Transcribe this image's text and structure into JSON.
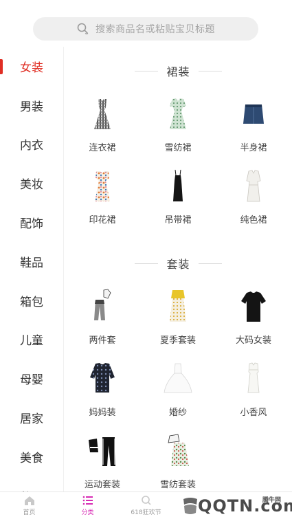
{
  "search": {
    "placeholder": "搜索商品名或粘贴宝贝标题"
  },
  "sidebar": {
    "items": [
      {
        "label": "女装",
        "active": true
      },
      {
        "label": "男装"
      },
      {
        "label": "内衣"
      },
      {
        "label": "美妆"
      },
      {
        "label": "配饰"
      },
      {
        "label": "鞋品"
      },
      {
        "label": "箱包"
      },
      {
        "label": "儿童"
      },
      {
        "label": "母婴"
      },
      {
        "label": "居家"
      },
      {
        "label": "美食"
      },
      {
        "label": "数码"
      }
    ]
  },
  "content": {
    "sections": [
      {
        "title": "裙装",
        "items": [
          {
            "label": "连衣裙",
            "icon": "plaid-dress-icon"
          },
          {
            "label": "雪纺裙",
            "icon": "chiffon-dress-icon"
          },
          {
            "label": "半身裙",
            "icon": "denim-skirt-icon"
          },
          {
            "label": "印花裙",
            "icon": "print-dress-icon"
          },
          {
            "label": "吊带裙",
            "icon": "slip-dress-icon"
          },
          {
            "label": "纯色裙",
            "icon": "white-dress-icon"
          }
        ]
      },
      {
        "title": "套装",
        "items": [
          {
            "label": "两件套",
            "icon": "two-piece-set-icon"
          },
          {
            "label": "夏季套装",
            "icon": "summer-set-icon"
          },
          {
            "label": "大码女装",
            "icon": "plus-size-top-icon"
          },
          {
            "label": "妈妈装",
            "icon": "mom-blouse-icon"
          },
          {
            "label": "婚纱",
            "icon": "wedding-dress-icon"
          },
          {
            "label": "小香风",
            "icon": "tweed-dress-icon"
          },
          {
            "label": "运动套装",
            "icon": "sports-set-icon"
          },
          {
            "label": "雪纺套装",
            "icon": "chiffon-set-icon"
          }
        ]
      }
    ]
  },
  "bottom_nav": {
    "items": [
      {
        "label": "首页",
        "icon": "home-icon"
      },
      {
        "label": "分类",
        "icon": "category-list-icon",
        "active": true
      },
      {
        "label": "618狂欢节",
        "icon": "search-icon"
      },
      {
        "label": "",
        "icon": ""
      },
      {
        "label": "",
        "icon": ""
      }
    ]
  },
  "watermark": {
    "brand": "QQTN.com",
    "small": "腾牛网"
  },
  "colors": {
    "accent": "#e02e24",
    "nav_active": "#d72bb4",
    "search_bg": "#efefef"
  }
}
